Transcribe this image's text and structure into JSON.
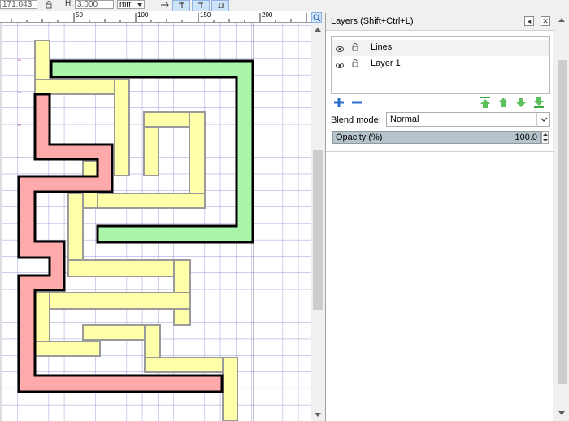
{
  "toolbar": {
    "x_value": "171.043",
    "h_label": "H:",
    "h_value": "3.000",
    "unit": "mm"
  },
  "ruler": {
    "ticks": [
      "50",
      "100",
      "150",
      "200"
    ]
  },
  "layers_panel": {
    "title": "Layers (Shift+Ctrl+L)",
    "layers": [
      {
        "name": "Lines"
      },
      {
        "name": "Layer 1"
      }
    ],
    "blend_label": "Blend mode:",
    "blend_value": "Normal",
    "opacity_label": "Opacity (%)",
    "opacity_value": "100.0"
  },
  "colors": {
    "path_yellow": "#ffffaa",
    "path_green": "#aaf5aa",
    "path_red": "#ffaaaa",
    "grid_line": "#6a6acc",
    "selection_accent": "#cde3f7"
  },
  "icons": [
    "lock-icon",
    "snap-icon",
    "zoom-icon",
    "eye-icon",
    "add-layer-icon",
    "remove-layer-icon",
    "raise-to-top-icon",
    "raise-icon",
    "lower-icon",
    "lower-to-bottom-icon",
    "chevron-down-icon",
    "close-icon"
  ]
}
